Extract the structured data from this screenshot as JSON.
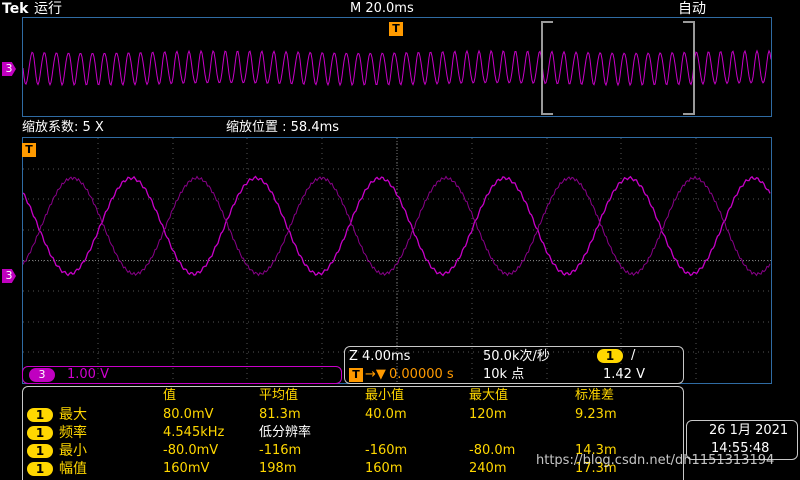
{
  "header": {
    "logo": "Tek",
    "run_state": "运行",
    "timebase": "M 20.0ms",
    "trigger_mode": "自动"
  },
  "zoom": {
    "factor_label": "缩放系数: 5 X",
    "position_label": "缩放位置 : 58.4ms"
  },
  "channel": {
    "number": "3",
    "scale": "1.00 V",
    "trace_color": "#c800c8"
  },
  "horizontal": {
    "zoom_time": "Z 4.00ms",
    "sample_rate": "50.0k次/秒",
    "trigger_position": "0.00000 s",
    "record_length": "10k 点",
    "trigger_channel": "1",
    "trigger_slope": "/",
    "trigger_level": "1.42 V"
  },
  "measurements": {
    "headers": [
      "值",
      "平均值",
      "最小值",
      "最大值",
      "标准差"
    ],
    "rows": [
      {
        "ch": "1",
        "name": "最大",
        "value": "80.0mV",
        "mean": "81.3m",
        "min": "40.0m",
        "max": "120m",
        "std": "9.23m"
      },
      {
        "ch": "1",
        "name": "频率",
        "value": "4.545kHz",
        "mean": "低分辨率",
        "min": "",
        "max": "",
        "std": ""
      },
      {
        "ch": "1",
        "name": "最小",
        "value": "-80.0mV",
        "mean": "-116m",
        "min": "-160m",
        "max": "-80.0m",
        "std": "14.3m"
      },
      {
        "ch": "1",
        "name": "幅值",
        "value": "160mV",
        "mean": "198m",
        "min": "160m",
        "max": "240m",
        "std": "17.3m"
      }
    ]
  },
  "datetime": {
    "date": "26 1月 2021",
    "time": "14:55:48"
  },
  "watermark": "https://blog.csdn.net/dh1151313194",
  "colors": {
    "accent_yellow": "#ffd700",
    "grid_blue": "#2f6ba3",
    "trigger_orange": "#ff9a00"
  }
}
